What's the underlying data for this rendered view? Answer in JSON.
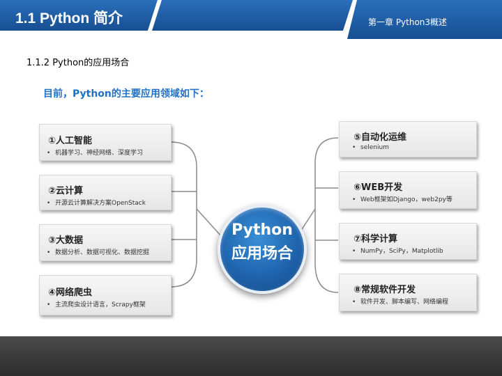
{
  "header": {
    "title": "1.1 Python 简介",
    "chapter": "第一章   Python3概述"
  },
  "section_title": "1.1.2 Python的应用场合",
  "lead_text": "目前，Python的主要应用领域如下：",
  "center": {
    "line1": "Python",
    "line2": "应用场合"
  },
  "left_items": [
    {
      "title": "①人工智能",
      "detail": "机器学习、神经网络、深度学习"
    },
    {
      "title": "②云计算",
      "detail": "开源云计算解决方案OpenStack"
    },
    {
      "title": "③大数据",
      "detail": "数据分析、数据可视化、数据挖掘"
    },
    {
      "title": "④网络爬虫",
      "detail": "主流爬虫设计语言，Scrapy框架"
    }
  ],
  "right_items": [
    {
      "title": "⑤自动化运维",
      "detail": "selenium"
    },
    {
      "title": "⑥WEB开发",
      "detail": "Web框架如Django，web2py等"
    },
    {
      "title": "⑦科学计算",
      "detail": "NumPy，SciPy，Matplotlib"
    },
    {
      "title": "⑧常规软件开发",
      "detail": "软件开发、脚本编写、网络编程"
    }
  ],
  "bullet": "•",
  "colors": {
    "header_blue": "#1f5fa8",
    "lead_text": "#1f72c8",
    "circle_blue": "#1f64ae"
  }
}
